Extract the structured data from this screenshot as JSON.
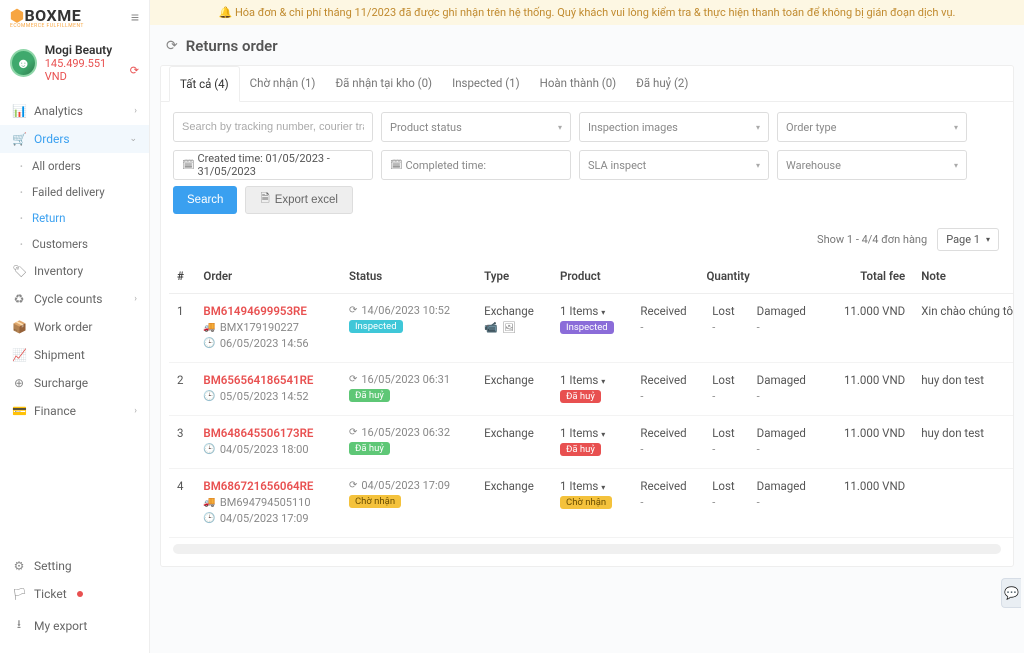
{
  "banner": "🔔 Hóa đơn & chi phí tháng 11/2023 đã được ghi nhận trên hệ thống. Quý khách vui lòng kiểm tra & thực hiện thanh toán để không bị gián đoạn dịch vụ.",
  "brand": {
    "name": "BOXME",
    "tagline": "ECOMMERCE FULFILLMENT"
  },
  "user": {
    "name": "Mogi Beauty",
    "balance": "145.499.551 VND"
  },
  "nav": {
    "analytics": "Analytics",
    "orders": "Orders",
    "all_orders": "All orders",
    "failed": "Failed delivery",
    "return": "Return",
    "customers": "Customers",
    "inventory": "Inventory",
    "cycle": "Cycle counts",
    "work": "Work order",
    "shipment": "Shipment",
    "surcharge": "Surcharge",
    "finance": "Finance",
    "setting": "Setting",
    "ticket": "Ticket",
    "export": "My export"
  },
  "page": {
    "title": "Returns order"
  },
  "tabs": {
    "all": "Tất cả (4)",
    "waiting": "Chờ nhận (1)",
    "received": "Đã nhận tại kho (0)",
    "inspected": "Inspected (1)",
    "done": "Hoàn thành (0)",
    "cancel": "Đã huỷ (2)"
  },
  "filters": {
    "search_ph": "Search by tracking number, courier tracking n",
    "product_status": "Product status",
    "inspect_img": "Inspection images",
    "order_type": "Order type",
    "created": "Created time: 01/05/2023 - 31/05/2023",
    "completed": "Completed time:",
    "sla": "SLA inspect",
    "warehouse": "Warehouse",
    "search_btn": "Search",
    "export_btn": "Export excel"
  },
  "pager": {
    "summary": "Show 1 - 4/4 đơn hàng",
    "page": "Page 1"
  },
  "cols": {
    "idx": "#",
    "order": "Order",
    "status": "Status",
    "type": "Type",
    "product": "Product",
    "qty": "Quantity",
    "fee": "Total fee",
    "note": "Note"
  },
  "qty_labels": {
    "received": "Received",
    "lost": "Lost",
    "damaged": "Damaged"
  },
  "badges": {
    "inspected": "Inspected",
    "cancel": "Đã huỷ",
    "waiting": "Chờ nhận"
  },
  "rows": [
    {
      "idx": "1",
      "code": "BM61494699953RE",
      "track": "BMX179190227",
      "created": "06/05/2023 14:56",
      "status_time": "14/06/2023 10:52",
      "badge": "inspected",
      "type": "Exchange",
      "items": "1 Items",
      "icons": true,
      "fee": "11.000 VND",
      "note": "Xin chào chúng tôi đang te"
    },
    {
      "idx": "2",
      "code": "BM656564186541RE",
      "track": "",
      "created": "05/05/2023 14:52",
      "status_time": "16/05/2023 06:31",
      "badge": "cancel",
      "type": "Exchange",
      "items": "1 Items",
      "fee": "11.000 VND",
      "note": "huy don test"
    },
    {
      "idx": "3",
      "code": "BM648645506173RE",
      "track": "",
      "created": "04/05/2023 18:00",
      "status_time": "16/05/2023 06:32",
      "badge": "cancel",
      "type": "Exchange",
      "items": "1 Items",
      "fee": "11.000 VND",
      "note": "huy don test"
    },
    {
      "idx": "4",
      "code": "BM686721656064RE",
      "track": "BM694794505110",
      "created": "04/05/2023 17:09",
      "status_time": "04/05/2023 17:09",
      "badge": "waiting",
      "type": "Exchange",
      "items": "1 Items",
      "fee": "11.000 VND",
      "note": ""
    }
  ]
}
